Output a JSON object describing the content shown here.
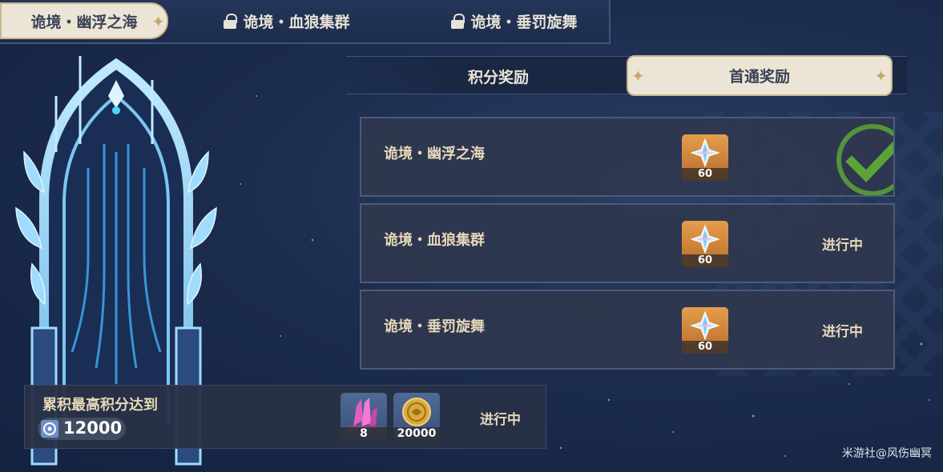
{
  "region_tabs": [
    {
      "label": "诡境・幽浮之海",
      "active": true,
      "locked": false
    },
    {
      "label": "诡境・血狼集群",
      "active": false,
      "locked": true
    },
    {
      "label": "诡境・垂罚旋舞",
      "active": false,
      "locked": true
    }
  ],
  "reward_tabs": [
    {
      "label": "积分奖励",
      "active": false
    },
    {
      "label": "首通奖励",
      "active": true
    }
  ],
  "rewards": [
    {
      "name": "诡境・幽浮之海",
      "item_icon": "primogem-icon",
      "quantity": "60",
      "status": "",
      "completed": true
    },
    {
      "name": "诡境・血狼集群",
      "item_icon": "primogem-icon",
      "quantity": "60",
      "status": "进行中",
      "completed": false
    },
    {
      "name": "诡境・垂罚旋舞",
      "item_icon": "primogem-icon",
      "quantity": "60",
      "status": "进行中",
      "completed": false
    }
  ],
  "cumulative": {
    "label": "累积最高积分达到",
    "score": "12000",
    "items": [
      {
        "icon": "crystal-icon",
        "quantity": "8"
      },
      {
        "icon": "mora-coin-icon",
        "quantity": "20000"
      }
    ],
    "status": "进行中"
  },
  "watermark": "米游社@风伤幽冥",
  "colors": {
    "background": "#1c2c4d",
    "active_tab": "#ece5d6",
    "row_bg": "#2f374e",
    "check_green": "#5aa437",
    "item_orange": "#d8893f",
    "text_gold": "#e6d8b8"
  }
}
